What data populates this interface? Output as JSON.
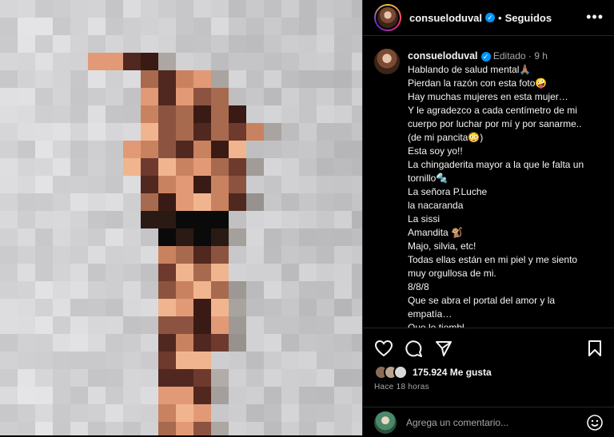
{
  "header": {
    "username": "consueloduval",
    "following": "Seguidos",
    "more_icon": "more-horizontal-icon"
  },
  "caption": {
    "username": "consueloduval",
    "edited": "Editado",
    "time": "9 h",
    "lines": [
      "Hablando de salud mental🙏🏽",
      "Pierdan la razón con esta foto🤪",
      "Hay muchas mujeres en esta mujer…",
      "Y le agradezco a cada centímetro de mi",
      "cuerpo por luchar por mí y por sanarme..",
      "(de mi pancita😳)",
      "Esta soy yo!!",
      "La chingaderita mayor a la que le falta un",
      "tornillo🔩",
      "La señora P.Luche",
      "la nacaranda",
      "La sissi",
      "Amandita 🐒",
      "Majo, silvia, etc!",
      "Todas ellas están en mi piel y me siento",
      "muy orgullosa de mi.",
      "8/8/8",
      "Que se abra el portal del amor y la",
      "empatía…",
      "Que le tiembl..."
    ]
  },
  "actions": {
    "likes": "175.924 Me gusta",
    "time": "Hace 18 horas",
    "comment_placeholder": "Agrega un comentario...",
    "icons": [
      "heart-icon",
      "comment-icon",
      "share-icon",
      "bookmark-icon"
    ]
  },
  "colors": {
    "background": "#000000",
    "text": "#f5f5f5",
    "muted": "#a8a8a8",
    "verified": "#0095f6",
    "divider": "#262626"
  }
}
